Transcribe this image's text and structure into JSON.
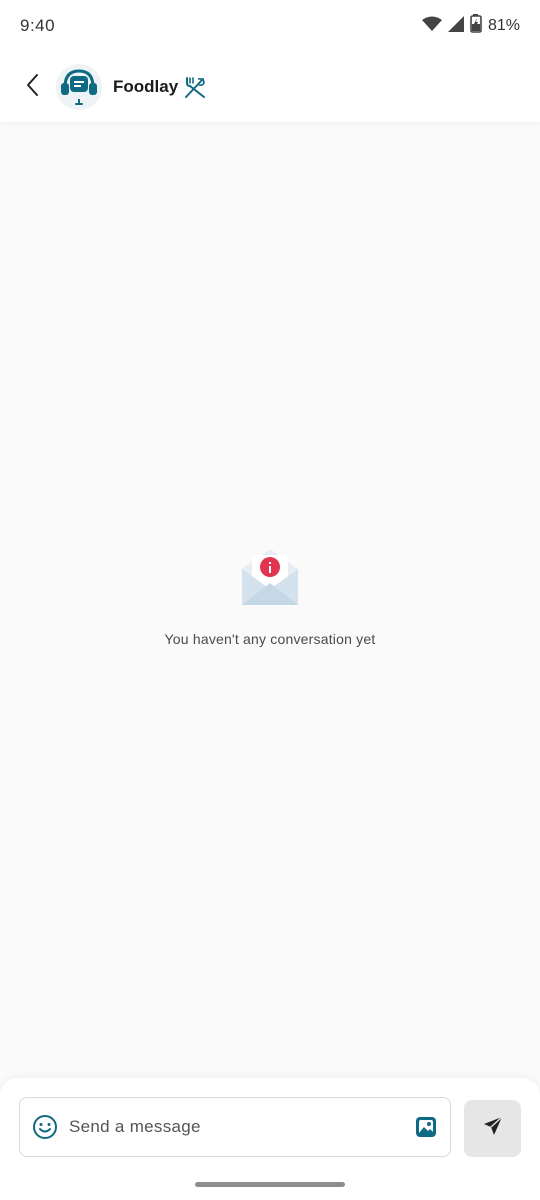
{
  "status_bar": {
    "time": "9:40",
    "battery": "81%",
    "icons": [
      "wifi-icon",
      "signal-icon",
      "battery-charging-icon"
    ]
  },
  "header": {
    "back_icon": "chevron-left-icon",
    "avatar_icon": "support-headset-icon",
    "title": "Foodlay",
    "brand_icon": "fork-knife-icon"
  },
  "empty_state": {
    "icon": "envelope-info-icon",
    "message": "You haven't any conversation yet"
  },
  "composer": {
    "placeholder": "Send a message",
    "emoji_icon": "smiley-icon",
    "image_icon": "image-icon",
    "send_icon": "send-icon"
  },
  "colors": {
    "accent": "#0f6a83",
    "alert_red": "#e0344f",
    "envelope": "#d3e2ec",
    "background": "#fafafa"
  }
}
